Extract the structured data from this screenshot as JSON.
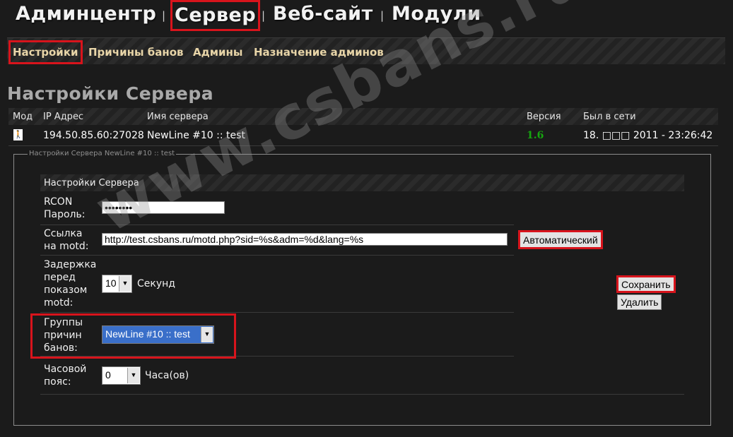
{
  "topnav": {
    "items": [
      "Админцентр",
      "Сервер",
      "Веб-сайт",
      "Модули"
    ],
    "separator": "|"
  },
  "subnav": {
    "items": [
      "Настройки",
      "Причины банов",
      "Админы",
      "Назначение админов"
    ]
  },
  "page_title": "Настройки Сервера",
  "server_table": {
    "headers": [
      "Мод",
      "IP Адрес",
      "Имя сервера",
      "Версия",
      "Был в сети"
    ],
    "row": {
      "ip": "194.50.85.60:27028",
      "name": "NewLine #10 :: test",
      "version": "1.6",
      "last_online": "18. □□□ 2011 - 23:26:42"
    }
  },
  "fieldset_legend": "Настройки Сервера NewLine #10 :: test",
  "form": {
    "header": "Настройки Сервера",
    "rcon_label": "RCON\nПароль:",
    "rcon_value": "••••••••",
    "motd_label": "Ссылка\nна motd:",
    "motd_value": "http://test.csbans.ru/motd.php?sid=%s&adm=%d&lang=%s",
    "auto_button": "Автоматический",
    "delay_label": "Задержка\nперед\nпоказом\nmotd:",
    "delay_value": "10",
    "delay_unit": "Секунд",
    "groups_label": "Группы\nпричин\nбанов:",
    "groups_value": "NewLine #10 :: test",
    "timezone_label": "Часовой\nпояс:",
    "timezone_value": "0",
    "timezone_unit": "Часа(ов)",
    "save_button": "Сохранить",
    "delete_button": "Удалить"
  },
  "watermark": "www.csbans.ru",
  "colors": {
    "highlight_border": "#d8141c",
    "version_green": "#16a60f",
    "subnav_text": "#e8d5a8",
    "selection_blue": "#3a6fc9"
  }
}
